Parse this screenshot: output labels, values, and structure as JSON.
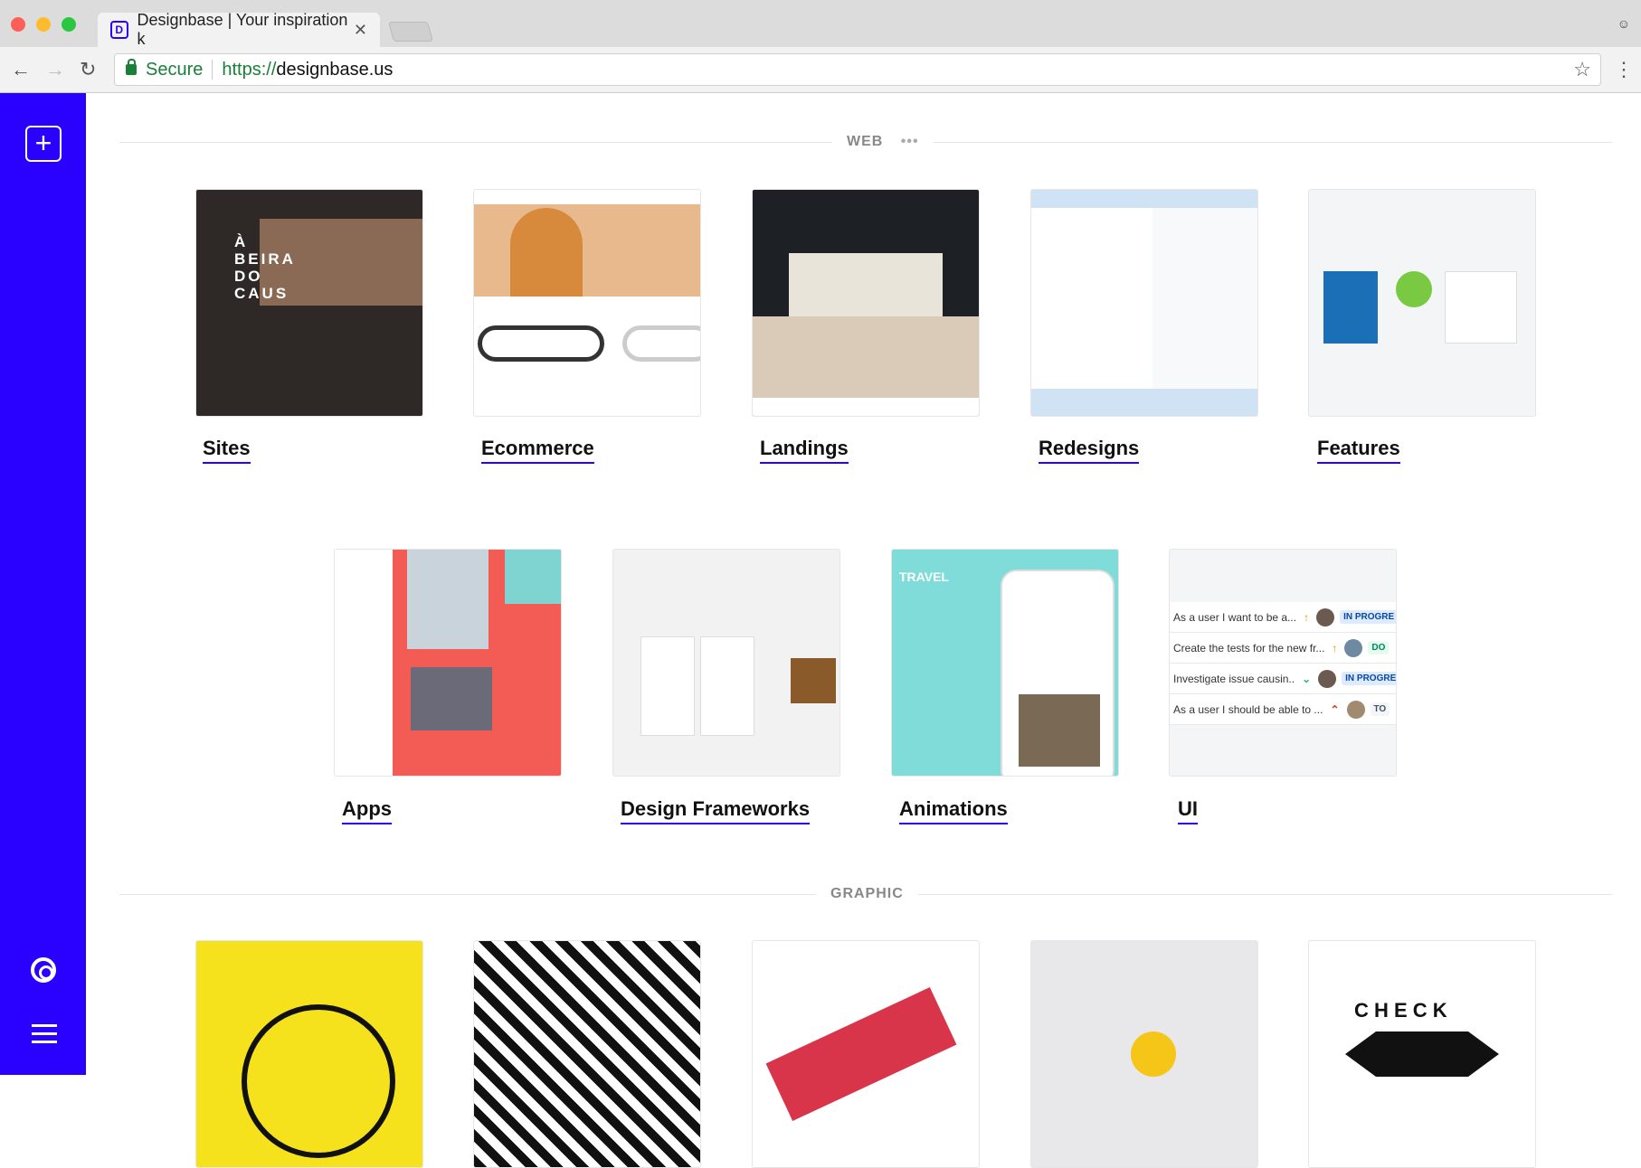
{
  "browser": {
    "tab_title": "Designbase | Your inspiration k",
    "favicon_letter": "D",
    "secure_label": "Secure",
    "url_scheme": "https://",
    "url_host": "designbase.us"
  },
  "sections": {
    "web": {
      "title": "WEB",
      "more": "•••"
    },
    "graphic": {
      "title": "GRAPHIC"
    }
  },
  "web_categories": [
    {
      "label": "Sites",
      "color": "#2e2926"
    },
    {
      "label": "Ecommerce",
      "color": "#f3ede6"
    },
    {
      "label": "Landings",
      "color": "#2b2f33"
    },
    {
      "label": "Redesigns",
      "color": "#cfe3f5"
    },
    {
      "label": "Features",
      "color": "#eef0f3"
    },
    {
      "label": "Apps",
      "color": "#f25c54"
    },
    {
      "label": "Design Frameworks",
      "color": "#f2f2f3"
    },
    {
      "label": "Animations",
      "color": "#7fdcd8"
    },
    {
      "label": "UI",
      "color": "#f4f5f7"
    }
  ],
  "ui_preview": [
    {
      "text": "As a user I want to be a...",
      "priority": "↑",
      "status": "IN PROGRE"
    },
    {
      "text": "Create the tests for the new fr...",
      "priority": "↑",
      "status": "DO"
    },
    {
      "text": "Investigate issue causin..",
      "priority": "⌄",
      "status": "IN PROGRE"
    },
    {
      "text": "As a user I should be able to ...",
      "priority": "⌃",
      "status": "TO"
    }
  ],
  "graphic_previews": [
    {
      "color": "#f5e21c"
    },
    {
      "color": "#111111"
    },
    {
      "color": "#ffffff"
    },
    {
      "color": "#e8e8ea"
    },
    {
      "color": "#ffffff",
      "text": "C H E C K"
    }
  ]
}
